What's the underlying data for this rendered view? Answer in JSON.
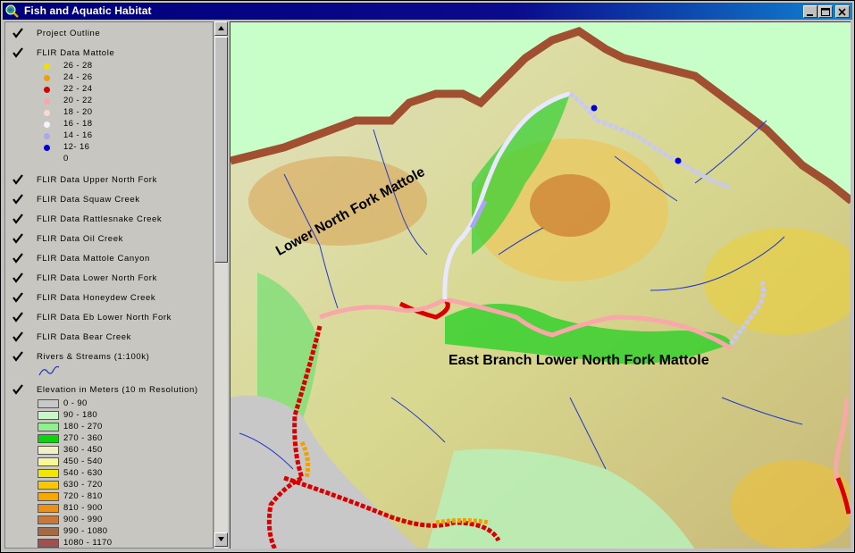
{
  "window": {
    "title": "Fish and Aquatic Habitat"
  },
  "legend": {
    "project_outline": "Project Outline",
    "flir_mattole": {
      "label": "FLIR Data Mattole",
      "classes": [
        {
          "label": "26 - 28",
          "color": "#f0e000"
        },
        {
          "label": "24 - 26",
          "color": "#f0a000"
        },
        {
          "label": "22 - 24",
          "color": "#d80000"
        },
        {
          "label": "20 - 22",
          "color": "#f8a8a8"
        },
        {
          "label": "18 - 20",
          "color": "#f8d8d8"
        },
        {
          "label": "16 - 18",
          "color": "#f4f4ff"
        },
        {
          "label": "14 - 16",
          "color": "#a8a8f0"
        },
        {
          "label": "12- 16",
          "color": "#0000d8"
        },
        {
          "label": "0",
          "color": ""
        }
      ]
    },
    "layers": [
      "FLIR Data Upper North Fork",
      "FLIR Data Squaw Creek",
      "FLIR Data Rattlesnake Creek",
      "FLIR Data Oil Creek",
      "FLIR Data Mattole Canyon",
      "FLIR Data Lower North Fork",
      "FLIR Data Honeydew Creek",
      "FLIR Data Eb Lower North Fork",
      "FLIR Data Bear Creek"
    ],
    "rivers": "Rivers & Streams (1:100k)",
    "elevation": {
      "label": "Elevation in Meters (10 m Resolution)",
      "classes": [
        {
          "label": "0 - 90",
          "color": "#c8c8c8"
        },
        {
          "label": "90 - 180",
          "color": "#c8f8c8"
        },
        {
          "label": "180 - 270",
          "color": "#90f090"
        },
        {
          "label": "270 - 360",
          "color": "#10d010"
        },
        {
          "label": "360 - 450",
          "color": "#f0f0c8"
        },
        {
          "label": "450 - 540",
          "color": "#f8f898"
        },
        {
          "label": "540 - 630",
          "color": "#f0e800"
        },
        {
          "label": "630 - 720",
          "color": "#f8c800"
        },
        {
          "label": "720 - 810",
          "color": "#f8a800"
        },
        {
          "label": "810 - 900",
          "color": "#e89020"
        },
        {
          "label": "900 - 990",
          "color": "#c87838"
        },
        {
          "label": "990 - 1080",
          "color": "#a86840"
        },
        {
          "label": "1080 - 1170",
          "color": "#a05050"
        }
      ]
    }
  },
  "map": {
    "labels": {
      "lower_north_fork": "Lower North Fork Mattole",
      "east_branch": "East Branch Lower North Fork Mattole"
    }
  }
}
